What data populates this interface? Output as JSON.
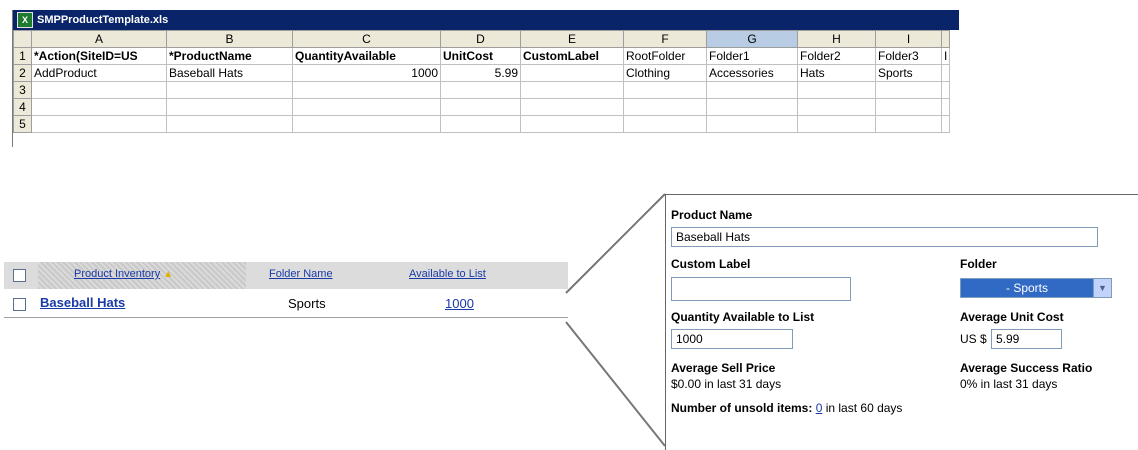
{
  "spreadsheet": {
    "title": "SMPProductTemplate.xls",
    "icon": "excel-icon",
    "columns": [
      "A",
      "B",
      "C",
      "D",
      "E",
      "F",
      "G",
      "H",
      "I",
      ""
    ],
    "selected_column": "G",
    "rows": [
      {
        "num": "1",
        "cells": [
          "*Action(SiteID=US",
          "*ProductName",
          "QuantityAvailable",
          "UnitCost",
          "CustomLabel",
          "RootFolder",
          "Folder1",
          "Folder2",
          "Folder3",
          "I"
        ]
      },
      {
        "num": "2",
        "cells": [
          "AddProduct",
          "Baseball Hats",
          "1000",
          "5.99",
          "",
          "Clothing",
          "Accessories",
          "Hats",
          "Sports",
          ""
        ]
      },
      {
        "num": "3",
        "cells": [
          "",
          "",
          "",
          "",
          "",
          "",
          "",
          "",
          "",
          ""
        ]
      },
      {
        "num": "4",
        "cells": [
          "",
          "",
          "",
          "",
          "",
          "",
          "",
          "",
          "",
          ""
        ]
      },
      {
        "num": "5",
        "cells": [
          "",
          "",
          "",
          "",
          "",
          "",
          "",
          "",
          "",
          ""
        ]
      }
    ]
  },
  "inventory": {
    "headers": {
      "product": "Product Inventory",
      "folder": "Folder Name",
      "available": "Available to List"
    },
    "sort_icon": "sort-ascending-icon",
    "row": {
      "product": "Baseball Hats",
      "folder": "Sports",
      "available": "1000"
    }
  },
  "detail": {
    "product_name_label": "Product Name",
    "product_name_value": "Baseball Hats",
    "custom_label_label": "Custom Label",
    "custom_label_value": "",
    "folder_label": "Folder",
    "folder_value": "- Sports",
    "qty_label": "Quantity Available to List",
    "qty_value": "1000",
    "avg_cost_label": "Average Unit Cost",
    "currency_prefix": "US $",
    "avg_cost_value": "5.99",
    "avg_sell_label": "Average Sell Price",
    "avg_sell_value": "$0.00 in last 31 days",
    "avg_success_label": "Average Success Ratio",
    "avg_success_value": "0% in last 31 days",
    "unsold_label": "Number of unsold items:",
    "unsold_count": "0",
    "unsold_suffix": "in last 60 days"
  },
  "colors": {
    "title_bar": "#0a246a",
    "link": "#1a3aa8",
    "select_bg": "#316ac5"
  }
}
